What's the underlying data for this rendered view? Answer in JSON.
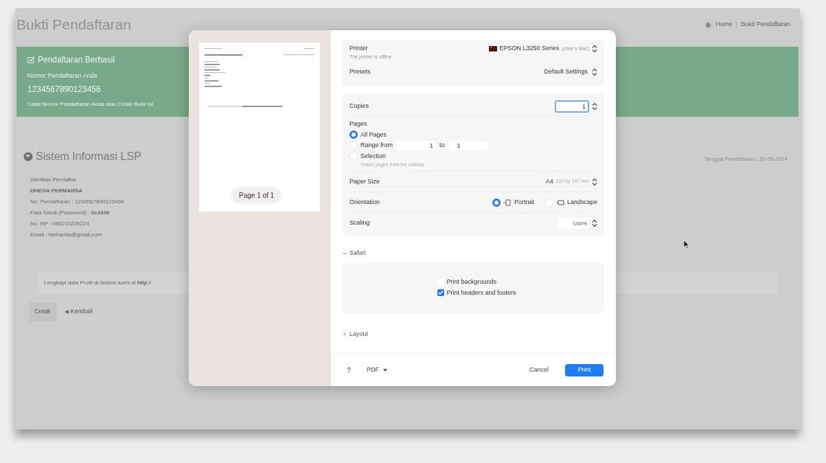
{
  "page": {
    "title": "Bukti Pendaftaran",
    "breadcrumb": [
      {
        "label": "Home"
      },
      {
        "label": "Bukti Pendaftaran"
      }
    ],
    "alert": {
      "title": "Pendaftaran Berhasil",
      "label": "Nomor Pendaftaran Anda",
      "number": "1234567890123456",
      "note": "Catat Nomor Pendaftaran Anda atau Cetak Bukti ini"
    },
    "section_title": "Sistem Informasi LSP",
    "date": "Tanggal Pendaftaran : 22-05-2024",
    "identity": {
      "heading": "Identitas Pendaftar",
      "name": "DHEGA FERMANSA",
      "lines": [
        "No. Pendaftaran : 1234567890123456",
        "Kata Sandi (Password) : **0c2d46**",
        "No. HP : 085210226224",
        "Email : fahhanita@gmail.com"
      ]
    },
    "notice": "Lengkapi data Profil di Sistem kami di **http:/**",
    "buttons": [
      {
        "label": "Cetak",
        "kind": "plain"
      },
      {
        "label": "Kembali",
        "kind": "back"
      }
    ]
  },
  "print_dialog": {
    "preview": {
      "page_label": "Page 1 of 1"
    },
    "printer": {
      "label": "Printer",
      "name": "EPSON L3250 Series",
      "location": "(User's Mac)",
      "status": "The printer is offline"
    },
    "presets": {
      "label": "Presets",
      "value": "Default Settings"
    },
    "copies": {
      "label": "Copies",
      "value": "1"
    },
    "pages": {
      "label": "Pages",
      "options": [
        {
          "kind": "plain",
          "label": "All Pages",
          "selected": true
        },
        {
          "kind": "range",
          "label": "Range from",
          "from": "1",
          "joiner": "to",
          "to": "1",
          "selected": false
        },
        {
          "kind": "hint",
          "label": "Selection",
          "hint": "Select pages from the sidebar",
          "selected": false
        }
      ]
    },
    "paper_size": {
      "label": "Paper Size",
      "value": "A4",
      "detail": "210 by 297 mm"
    },
    "orientation": {
      "label": "Orientation",
      "options": [
        {
          "label": "Portrait",
          "selected": true
        },
        {
          "label": "Landscape",
          "selected": false
        }
      ]
    },
    "scaling": {
      "label": "Scaling",
      "value": "100%"
    },
    "safari": {
      "label": "Safari",
      "expanded": true,
      "options": [
        {
          "label": "Print backgrounds",
          "checked": false
        },
        {
          "label": "Print headers and footers",
          "checked": true
        }
      ]
    },
    "layout": {
      "label": "Layout"
    },
    "footer": {
      "help": "?",
      "pdf": "PDF",
      "cancel": "Cancel",
      "print": "Print"
    }
  }
}
